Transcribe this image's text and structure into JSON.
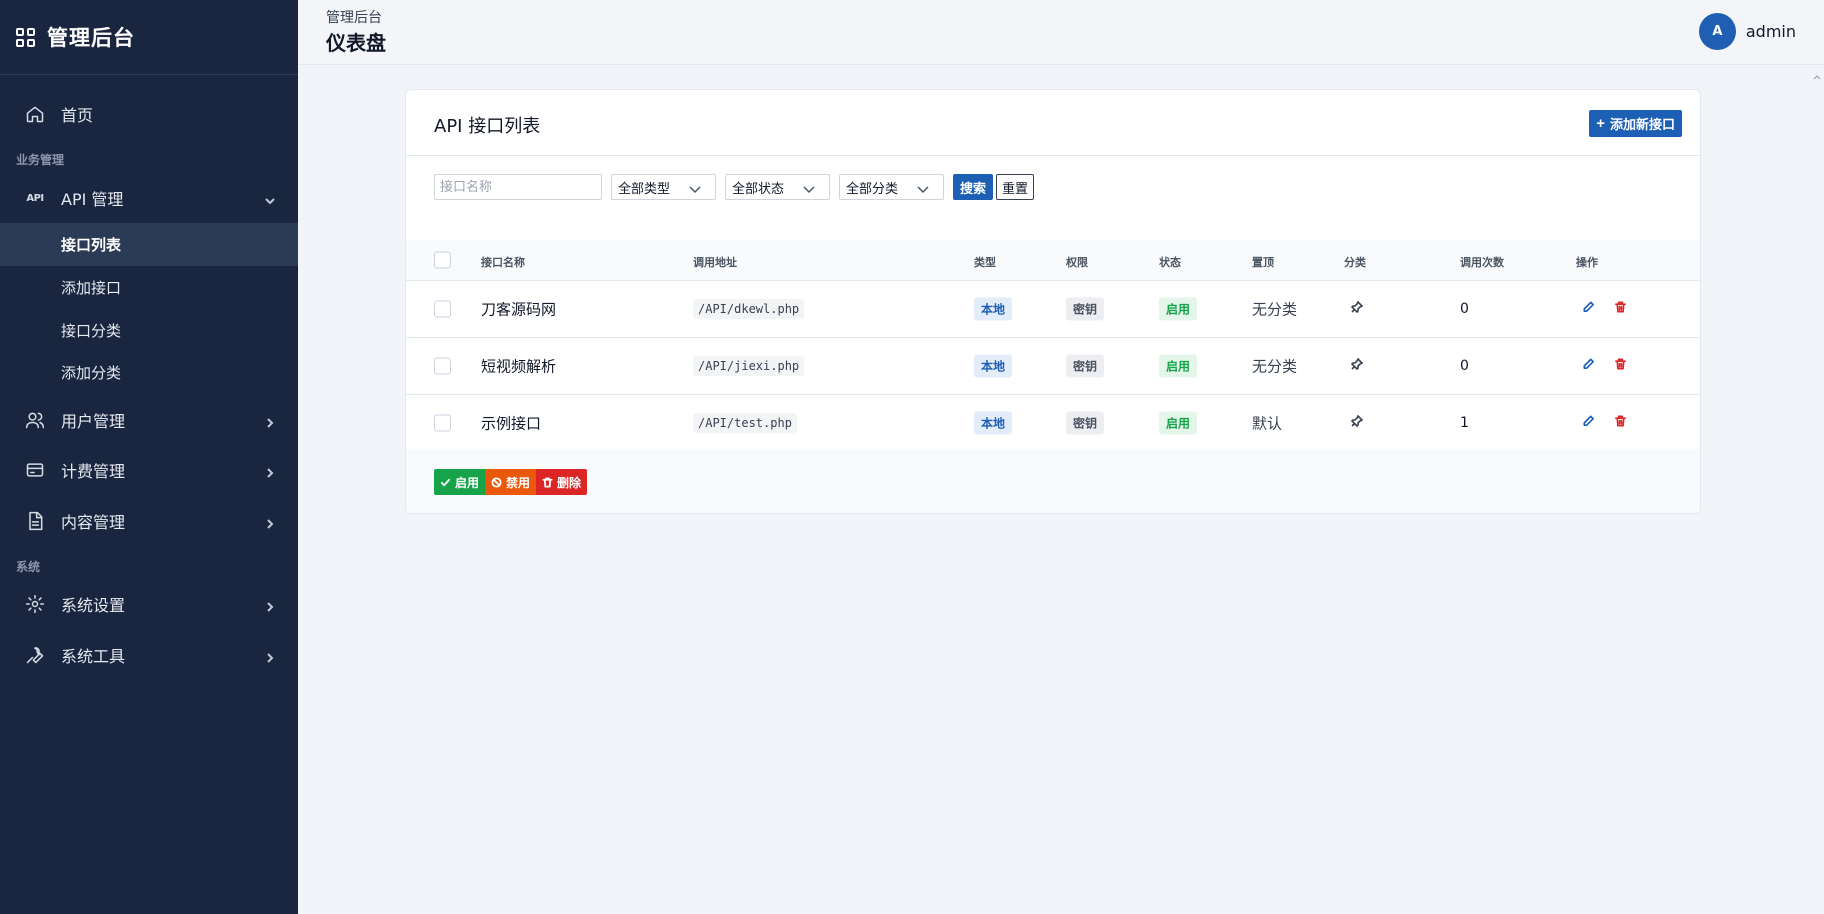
{
  "sidebar": {
    "brand": "管理后台",
    "home": "首页",
    "section_business": "业务管理",
    "api_manage": {
      "icon_text": "API",
      "label": "API 管理"
    },
    "sub_items": [
      "接口列表",
      "添加接口",
      "接口分类",
      "添加分类"
    ],
    "user_manage": "用户管理",
    "billing_manage": "计费管理",
    "content_manage": "内容管理",
    "section_system": "系统",
    "system_settings": "系统设置",
    "system_tools": "系统工具"
  },
  "header": {
    "breadcrumb": "管理后台",
    "title": "仪表盘",
    "avatar_letter": "A",
    "username": "admin"
  },
  "card": {
    "title": "API 接口列表",
    "add_button": "添加新接口"
  },
  "filters": {
    "name_placeholder": "接口名称",
    "type": "全部类型",
    "status": "全部状态",
    "category": "全部分类",
    "search": "搜索",
    "reset": "重置"
  },
  "table": {
    "columns": [
      "接口名称",
      "调用地址",
      "类型",
      "权限",
      "状态",
      "置顶",
      "分类",
      "调用次数",
      "操作"
    ],
    "rows": [
      {
        "name": "刀客源码网",
        "url": "/API/dkewl.php",
        "type": "本地",
        "perm": "密钥",
        "status": "启用",
        "category": "无分类",
        "count": "0"
      },
      {
        "name": "短视频解析",
        "url": "/API/jiexi.php",
        "type": "本地",
        "perm": "密钥",
        "status": "启用",
        "category": "无分类",
        "count": "0"
      },
      {
        "name": "示例接口",
        "url": "/API/test.php",
        "type": "本地",
        "perm": "密钥",
        "status": "启用",
        "category": "默认",
        "count": "1"
      }
    ]
  },
  "bulk": {
    "enable": "启用",
    "disable": "禁用",
    "delete": "删除"
  },
  "colors": {
    "sidebar_bg": "#1a2640",
    "primary": "#1d5fb5",
    "success": "#16a34a",
    "warning": "#ea580c",
    "danger": "#dc2626"
  }
}
